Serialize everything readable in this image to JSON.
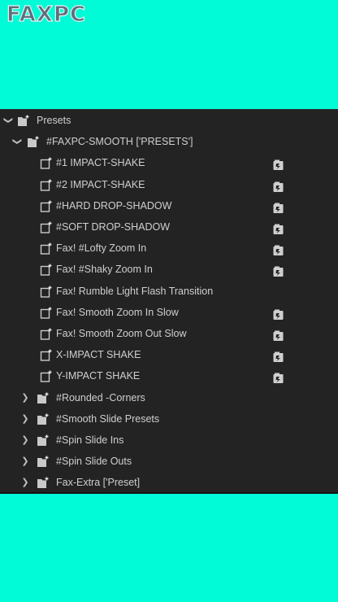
{
  "logo": {
    "text": "FAXPC"
  },
  "tree": {
    "root": {
      "label": "Presets",
      "state": "expanded",
      "icon": "folder-icon"
    },
    "group": {
      "label": "#FAXPC-SMOOTH ['PRESETS']",
      "state": "expanded",
      "icon": "folder-icon"
    },
    "presets": [
      {
        "label": "#1 IMPACT-SHAKE",
        "icon": "preset-icon",
        "badge": "effect-badge-icon"
      },
      {
        "label": "#2 IMPACT-SHAKE",
        "icon": "preset-icon",
        "badge": "effect-badge-icon"
      },
      {
        "label": "#HARD DROP-SHADOW",
        "icon": "preset-icon",
        "badge": "effect-badge-icon"
      },
      {
        "label": "#SOFT DROP-SHADOW",
        "icon": "preset-icon",
        "badge": "effect-badge-icon"
      },
      {
        "label": "Fax! #Lofty Zoom In",
        "icon": "preset-icon",
        "badge": "effect-badge-icon"
      },
      {
        "label": "Fax! #Shaky Zoom In",
        "icon": "preset-icon",
        "badge": "effect-badge-icon"
      },
      {
        "label": "Fax! Rumble Light Flash Transition",
        "icon": "preset-icon",
        "badge": ""
      },
      {
        "label": "Fax! Smooth Zoom In Slow",
        "icon": "preset-icon",
        "badge": "effect-badge-icon"
      },
      {
        "label": "Fax! Smooth Zoom Out Slow",
        "icon": "preset-icon",
        "badge": "effect-badge-icon"
      },
      {
        "label": "X-IMPACT SHAKE",
        "icon": "preset-icon",
        "badge": "effect-badge-icon"
      },
      {
        "label": "Y-IMPACT SHAKE",
        "icon": "preset-icon",
        "badge": "effect-badge-icon"
      }
    ],
    "folders": [
      {
        "label": "#Rounded -Corners",
        "state": "collapsed",
        "icon": "folder-icon"
      },
      {
        "label": "#Smooth Slide Presets",
        "state": "collapsed",
        "icon": "folder-icon"
      },
      {
        "label": "#Spin Slide Ins",
        "state": "collapsed",
        "icon": "folder-icon"
      },
      {
        "label": "#Spin Slide Outs",
        "state": "collapsed",
        "icon": "folder-icon"
      },
      {
        "label": "Fax-Extra ['Preset]",
        "state": "collapsed",
        "icon": "folder-icon"
      }
    ]
  },
  "colors": {
    "background": "#00fbd6",
    "panel": "#232323",
    "text": "#cfcfcf"
  }
}
